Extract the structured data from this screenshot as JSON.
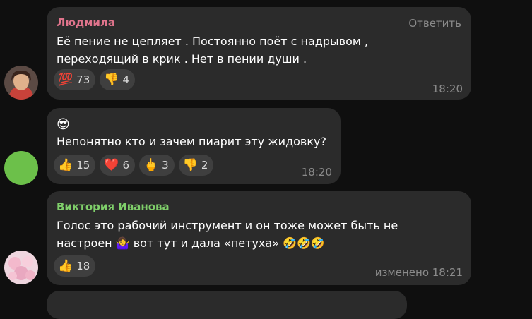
{
  "messages": [
    {
      "author": "Людмила",
      "author_color": "#e0748c",
      "reply_label": "Ответить",
      "lines": [
        "Её пение не цепляет . Постоянно поёт с надрывом ,",
        "переходящий в крик . Нет в пении души ."
      ],
      "reactions": [
        {
          "icon": "hundred-points-icon",
          "glyph": "💯",
          "count": "73"
        },
        {
          "icon": "thumbs-down-icon",
          "glyph": "👎",
          "count": "4"
        }
      ],
      "time": "18:20"
    },
    {
      "emoji_line": "😎",
      "lines": [
        "Непонятно кто и зачем пиарит эту жидовку?"
      ],
      "reactions": [
        {
          "icon": "thumbs-up-icon",
          "glyph": "👍",
          "count": "15"
        },
        {
          "icon": "heart-icon",
          "glyph": "❤️",
          "count": "6"
        },
        {
          "icon": "middle-finger-icon",
          "glyph": "🖕",
          "count": "3"
        },
        {
          "icon": "thumbs-down-icon",
          "glyph": "👎",
          "count": "2"
        }
      ],
      "time": "18:20"
    },
    {
      "author": "Виктория Иванова",
      "author_color": "#7fcf6a",
      "lines": [
        "Голос это рабочий инструмент и он тоже может быть не"
      ],
      "line2_start": "настроен",
      "line2_emoji1": "🤷‍♀️",
      "line2_mid": " вот тут и дала «петуха» ",
      "line2_emoji2": "🤣🤣🤣",
      "reactions": [
        {
          "icon": "thumbs-up-icon",
          "glyph": "👍",
          "count": "18"
        }
      ],
      "time": "изменено 18:21"
    }
  ]
}
